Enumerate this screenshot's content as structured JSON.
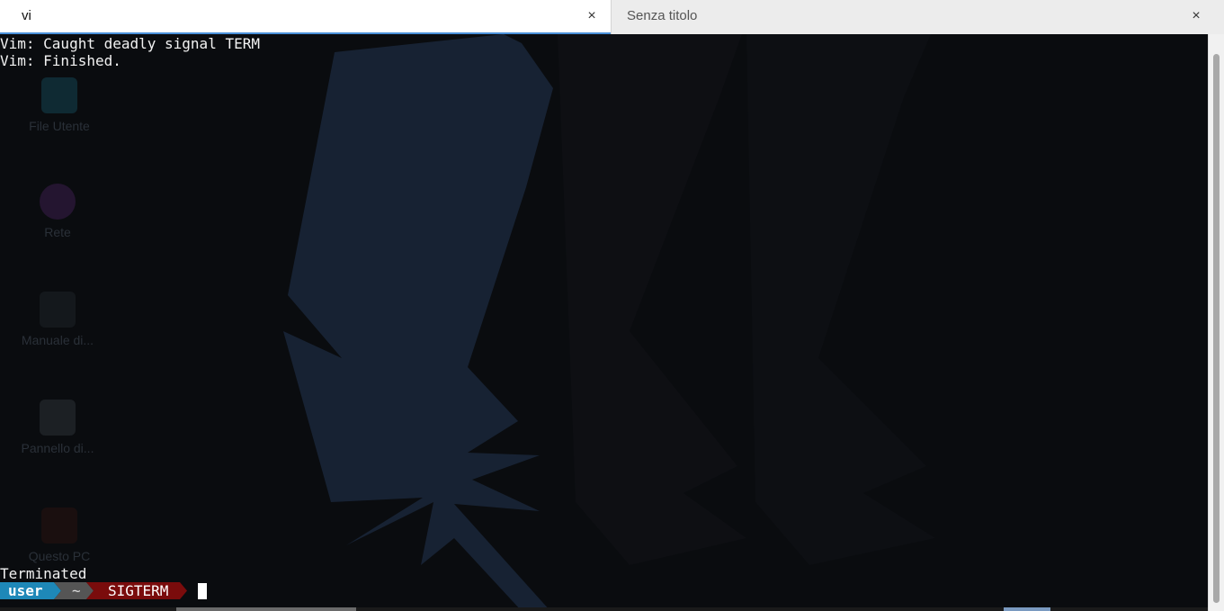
{
  "tabs": [
    {
      "label": "vi",
      "close": "×",
      "active": true
    },
    {
      "label": "Senza titolo",
      "close": "×",
      "active": false
    }
  ],
  "terminal": {
    "lines": [
      "Vim: Caught deadly signal TERM",
      "Vim: Finished."
    ],
    "status": "Terminated",
    "prompt": {
      "user": "user",
      "dir": "~",
      "status": "SIGTERM"
    }
  },
  "desktop_icons": [
    {
      "label": "File Utente",
      "icon": "home-folder-icon"
    },
    {
      "label": "Rete",
      "icon": "network-globe-icon"
    },
    {
      "label": "Manuale di...",
      "icon": "manual-map-icon"
    },
    {
      "label": "Pannello di...",
      "icon": "control-panel-icon"
    },
    {
      "label": "Questo PC",
      "icon": "computer-icon"
    }
  ],
  "colors": {
    "tab_accent": "#4a90d9",
    "prompt_user_bg": "#1e88b8",
    "prompt_dir_bg": "#555555",
    "prompt_status_bg": "#7a0c0c",
    "wallpaper_shape": "#172233"
  }
}
